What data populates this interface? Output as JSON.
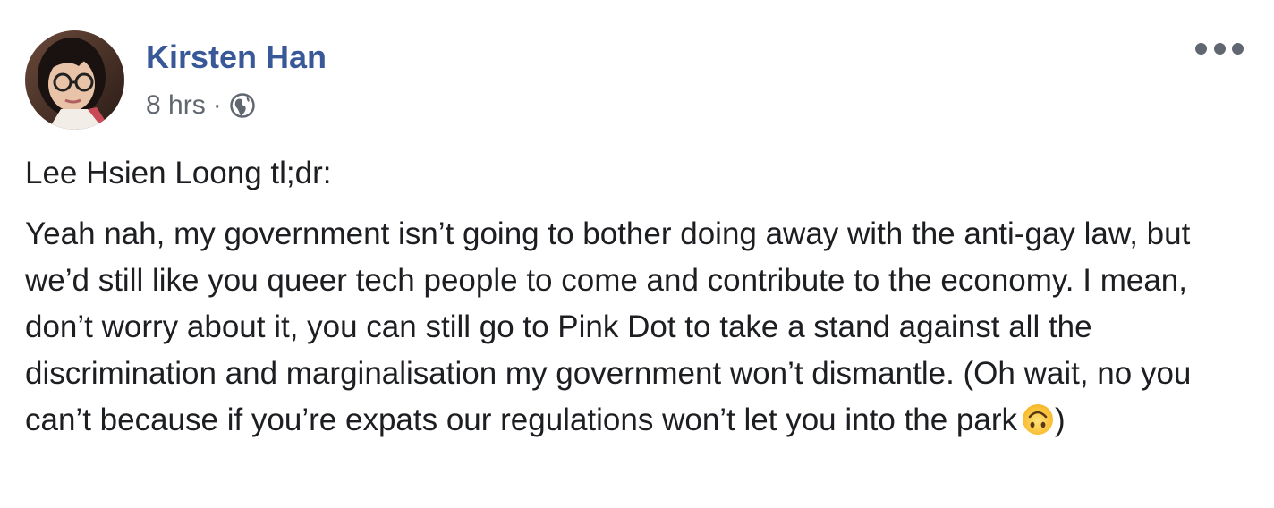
{
  "post": {
    "author": "Kirsten Han",
    "timestamp": "8 hrs",
    "separator": "·",
    "audience_icon": "globe-icon",
    "menu_icon": "more-options-icon",
    "intro": "Lee Hsien Loong tl;dr:",
    "body": "Yeah nah, my government isn’t going to bother doing away with the anti-gay law, but we’d still like you queer tech people to come and contribute to the economy. I mean, don’t worry about it, you can still go to Pink Dot to take a stand against all the discrimination and marginalisation my government won’t dismantle. (Oh wait, no you can’t because if you’re expats our regulations won’t let you into the park",
    "emoji": "upside-down-face-emoji",
    "body_end": ")"
  },
  "colors": {
    "author_link": "#385898",
    "meta_text": "#616770",
    "body_text": "#1c1e21",
    "background": "#ffffff"
  }
}
